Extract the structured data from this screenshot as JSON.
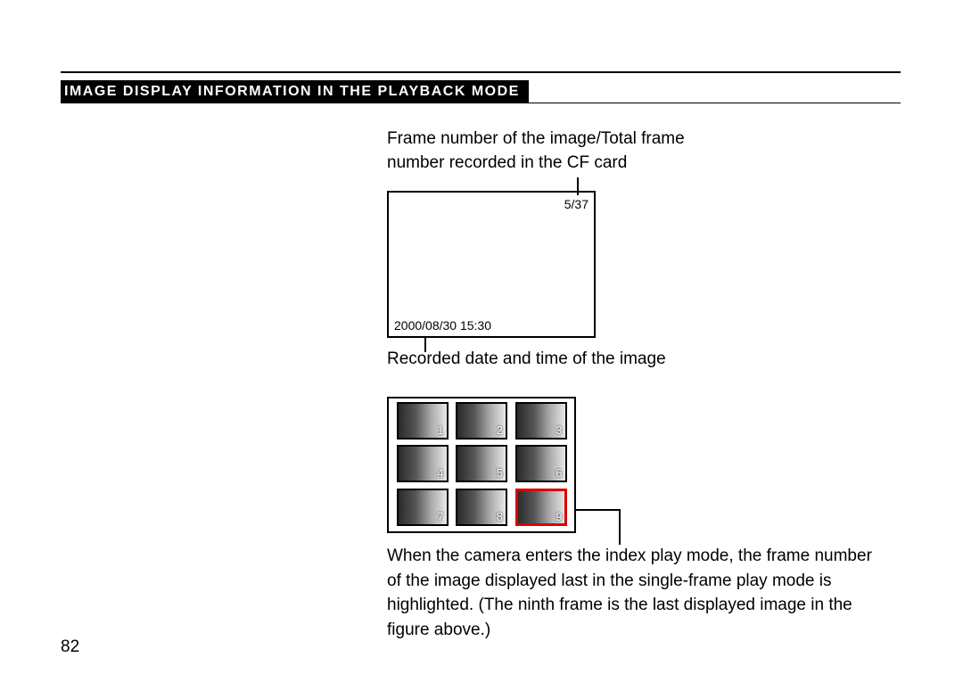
{
  "section_title": "IMAGE DISPLAY INFORMATION IN THE PLAYBACK MODE",
  "labels": {
    "frame_top_line1": "Frame number of the image/Total frame",
    "frame_top_line2": "number recorded in the CF card",
    "recorded_datetime": "Recorded date and time of the image"
  },
  "display": {
    "frame_counter": "5/37",
    "datetime": "2000/08/30 15:30"
  },
  "index_grid": {
    "cells": [
      "1",
      "2",
      "3",
      "4",
      "5",
      "6",
      "7",
      "8",
      "9"
    ],
    "highlighted_index": 8
  },
  "index_description": "When the camera enters the index play mode, the frame number of the image displayed last in the single-frame play mode is highlighted. (The ninth frame is the last displayed image in the figure above.)",
  "page_number": "82"
}
